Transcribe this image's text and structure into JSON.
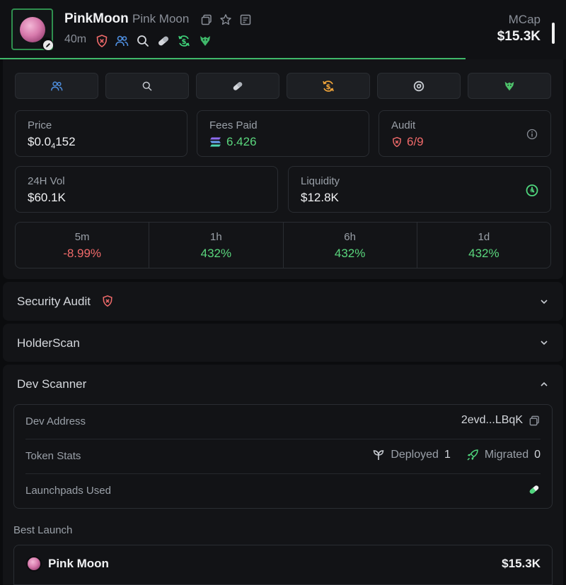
{
  "header": {
    "token_symbol": "PinkMoon",
    "token_name": "Pink Moon",
    "age": "40m",
    "mcap_label": "MCap",
    "mcap_value": "$15.3K"
  },
  "quick_actions": [
    {
      "icon": "users-icon",
      "color": "#4f8fe0"
    },
    {
      "icon": "search-icon",
      "color": "#c8ccd2"
    },
    {
      "icon": "pill-icon",
      "color": "#c8ccd2"
    },
    {
      "icon": "dollar-refresh-icon",
      "color": "#f0a43a"
    },
    {
      "icon": "at-sign-icon",
      "color": "#c8ccd2"
    },
    {
      "icon": "eagle-icon",
      "color": "#4fc46c"
    }
  ],
  "stats": {
    "price_label": "Price",
    "price_value_prefix": "$0.0",
    "price_value_sub": "4",
    "price_value_suffix": "152",
    "fees_label": "Fees Paid",
    "fees_value": "6.426",
    "audit_label": "Audit",
    "audit_value": "6/9",
    "vol_label": "24H Vol",
    "vol_value": "$60.1K",
    "liq_label": "Liquidity",
    "liq_value": "$12.8K"
  },
  "changes": [
    {
      "label": "5m",
      "value": "-8.99%",
      "dir": "down"
    },
    {
      "label": "1h",
      "value": "432%",
      "dir": "up"
    },
    {
      "label": "6h",
      "value": "432%",
      "dir": "up"
    },
    {
      "label": "1d",
      "value": "432%",
      "dir": "up"
    }
  ],
  "sections": {
    "security_audit": "Security Audit",
    "holder_scan": "HolderScan",
    "dev_scanner": "Dev Scanner"
  },
  "dev": {
    "address_label": "Dev Address",
    "address_value": "2evd...LBqK",
    "stats_label": "Token Stats",
    "deployed_label": "Deployed",
    "deployed_value": "1",
    "migrated_label": "Migrated",
    "migrated_value": "0",
    "launchpads_label": "Launchpads Used"
  },
  "best_launch": {
    "label": "Best Launch",
    "name": "Pink Moon",
    "mcap": "$15.3K"
  },
  "colors": {
    "accent_green": "#5ad67d",
    "danger_red": "#f06a6a",
    "background": "#0b0c0e"
  }
}
